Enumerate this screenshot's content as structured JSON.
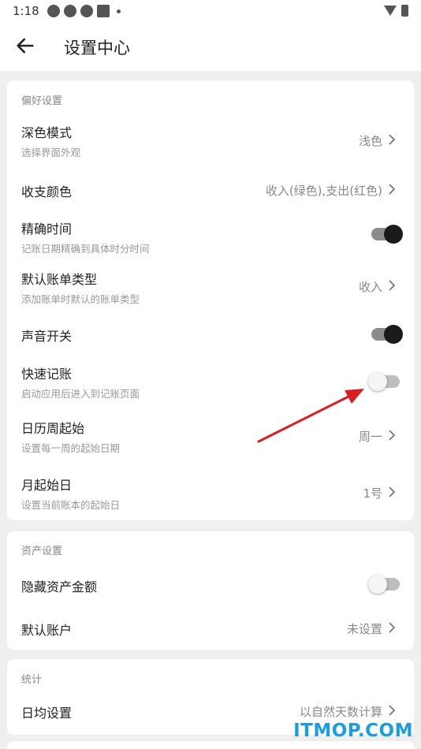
{
  "status_bar": {
    "time": "1:18"
  },
  "header": {
    "title": "设置中心",
    "back_icon": "arrow-left-icon"
  },
  "preferences": {
    "section_title": "偏好设置",
    "dark_mode": {
      "label": "深色模式",
      "sub": "选择界面外观",
      "value": "浅色"
    },
    "income_color": {
      "label": "收支颜色",
      "value": "收入(绿色),支出(红色)"
    },
    "precise_time": {
      "label": "精确时间",
      "sub": "记账日期精确到具体时分时间",
      "state": "on"
    },
    "default_bill_type": {
      "label": "默认账单类型",
      "sub": "添加账单时默认的账单类型",
      "value": "收入"
    },
    "sound": {
      "label": "声音开关",
      "state": "on"
    },
    "quick_bill": {
      "label": "快速记账",
      "sub": "启动应用后进入到记账页面",
      "state": "off"
    },
    "week_start": {
      "label": "日历周起始",
      "sub": "设置每一周的起始日期",
      "value": "周一"
    },
    "month_start": {
      "label": "月起始日",
      "sub": "设置当前账本的起始日",
      "value": "1号"
    }
  },
  "assets": {
    "section_title": "资产设置",
    "hide_amount": {
      "label": "隐藏资产金额",
      "state": "off"
    },
    "default_account": {
      "label": "默认账户",
      "value": "未设置"
    }
  },
  "statistics": {
    "section_title": "统计",
    "daily_average": {
      "label": "日均设置",
      "value": "以自然天数计算"
    }
  },
  "watermark": "ITMOP.COM",
  "colors": {
    "annotation_arrow": "#d81e1e",
    "watermark": "#1a9ce0",
    "toggle_on_knob": "#1a1a1a"
  }
}
